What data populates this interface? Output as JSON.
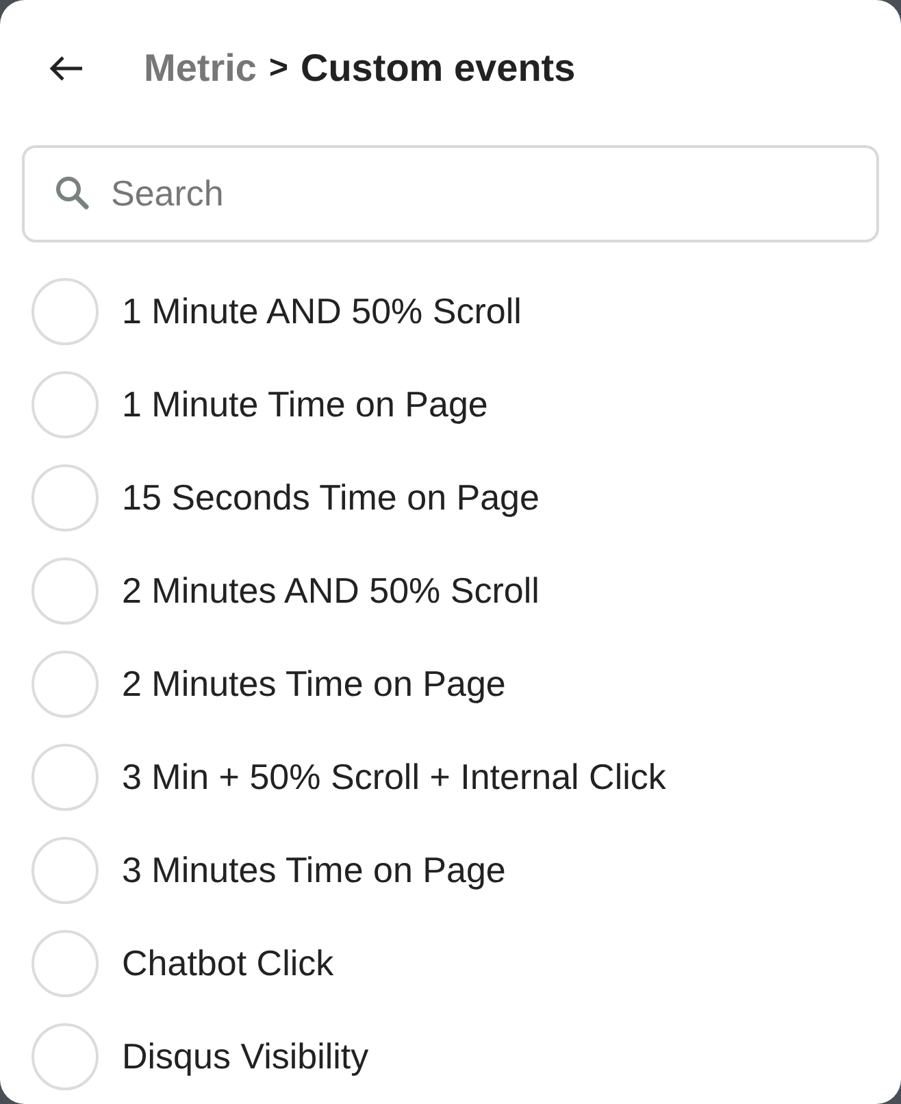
{
  "header": {
    "parent": "Metric",
    "separator": ">",
    "title": "Custom events"
  },
  "search": {
    "placeholder": "Search"
  },
  "events": [
    {
      "label": "1 Minute AND 50% Scroll",
      "selected": false
    },
    {
      "label": "1 Minute Time on Page",
      "selected": false
    },
    {
      "label": "15 Seconds Time on Page",
      "selected": false
    },
    {
      "label": "2 Minutes AND 50% Scroll",
      "selected": false
    },
    {
      "label": "2 Minutes Time on Page",
      "selected": false
    },
    {
      "label": "3 Min + 50% Scroll + Internal Click",
      "selected": false
    },
    {
      "label": "3 Minutes Time on Page",
      "selected": false
    },
    {
      "label": "Chatbot Click",
      "selected": false
    },
    {
      "label": "Disqus Visibility",
      "selected": false
    }
  ]
}
